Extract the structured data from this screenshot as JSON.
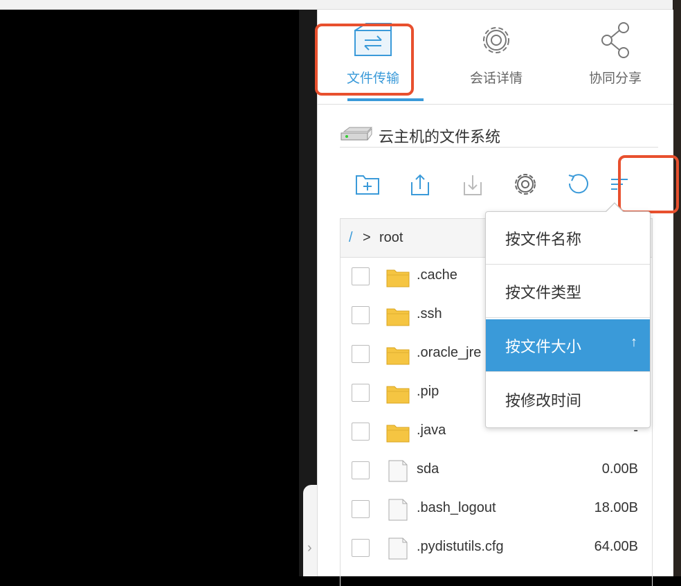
{
  "tabs": [
    {
      "label": "文件传输",
      "icon": "transfer-icon",
      "active": true
    },
    {
      "label": "会话详情",
      "icon": "gear-icon",
      "active": false
    },
    {
      "label": "协同分享",
      "icon": "share-icon",
      "active": false
    }
  ],
  "filesystem": {
    "title": "云主机的文件系统",
    "icon": "hard-disk-icon"
  },
  "toolbar": {
    "buttons": [
      "new-folder-icon",
      "upload-icon",
      "download-icon",
      "settings-icon",
      "refresh-icon",
      "sort-icon"
    ]
  },
  "breadcrumb": {
    "separator": "/",
    "arrow": ">",
    "current": "root"
  },
  "files": [
    {
      "name": ".cache",
      "type": "folder",
      "size": ""
    },
    {
      "name": ".ssh",
      "type": "folder",
      "size": ""
    },
    {
      "name": ".oracle_jre",
      "type": "folder",
      "size": ""
    },
    {
      "name": ".pip",
      "type": "folder",
      "size": ""
    },
    {
      "name": ".java",
      "type": "folder",
      "size": "-"
    },
    {
      "name": "sda",
      "type": "file",
      "size": "0.00B"
    },
    {
      "name": ".bash_logout",
      "type": "file",
      "size": "18.00B"
    },
    {
      "name": ".pydistutils.cfg",
      "type": "file",
      "size": "64.00B"
    }
  ],
  "sort_menu": {
    "options": [
      {
        "label": "按文件名称",
        "selected": false
      },
      {
        "label": "按文件类型",
        "selected": false
      },
      {
        "label": "按文件大小",
        "selected": true,
        "direction": "↑"
      },
      {
        "label": "按修改时间",
        "selected": false
      }
    ]
  },
  "colors": {
    "accent": "#3a9ad9",
    "highlight": "#e8502e",
    "folder": "#f5c542"
  }
}
